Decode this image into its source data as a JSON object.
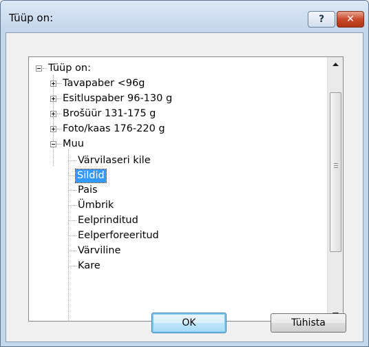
{
  "window": {
    "title": "Tüüp on:",
    "help_label": "?",
    "close_label": "✕"
  },
  "tree": {
    "root_label": "Tüüp on:",
    "top_items": [
      {
        "label": "Tavapaber <96g",
        "expanded": false
      },
      {
        "label": "Esitluspaber 96-130 g",
        "expanded": false
      },
      {
        "label": "Brošüür 131-175 g",
        "expanded": false
      },
      {
        "label": "Foto/kaas 176-220 g",
        "expanded": false
      },
      {
        "label": "Muu",
        "expanded": true
      }
    ],
    "muu_children": [
      {
        "label": "Värvilaseri kile",
        "selected": false
      },
      {
        "label": "Sildid",
        "selected": true
      },
      {
        "label": "Pais",
        "selected": false
      },
      {
        "label": "Ümbrik",
        "selected": false
      },
      {
        "label": "Eelprinditud",
        "selected": false
      },
      {
        "label": "Eelperforeeritud",
        "selected": false
      },
      {
        "label": "Värviline",
        "selected": false
      },
      {
        "label": "Kare",
        "selected": false
      }
    ]
  },
  "buttons": {
    "ok_label": "OK",
    "cancel_label": "Tühista"
  },
  "colors": {
    "selection": "#3399ff",
    "close_button": "#c74a2c",
    "default_button_border": "#3c7fb1"
  }
}
